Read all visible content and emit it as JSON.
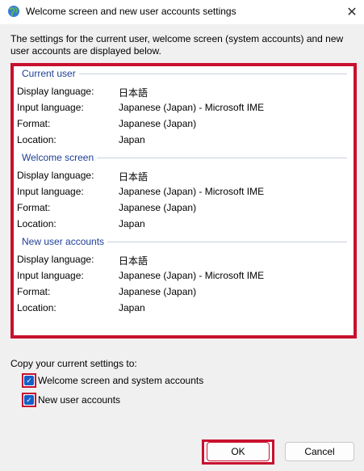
{
  "window": {
    "title": "Welcome screen and new user accounts settings",
    "close_glyph": "✕",
    "icon": "globe-icon"
  },
  "intro": "The settings for the current user, welcome screen (system accounts) and new user accounts are displayed below.",
  "sections": [
    {
      "title": "Current user",
      "rows": [
        {
          "label": "Display language:",
          "value": "日本語"
        },
        {
          "label": "Input language:",
          "value": "Japanese (Japan) - Microsoft IME"
        },
        {
          "label": "Format:",
          "value": "Japanese (Japan)"
        },
        {
          "label": "Location:",
          "value": "Japan"
        }
      ]
    },
    {
      "title": "Welcome screen",
      "rows": [
        {
          "label": "Display language:",
          "value": "日本語"
        },
        {
          "label": "Input language:",
          "value": "Japanese (Japan) - Microsoft IME"
        },
        {
          "label": "Format:",
          "value": "Japanese (Japan)"
        },
        {
          "label": "Location:",
          "value": "Japan"
        }
      ]
    },
    {
      "title": "New user accounts",
      "rows": [
        {
          "label": "Display language:",
          "value": "日本語"
        },
        {
          "label": "Input language:",
          "value": "Japanese (Japan) - Microsoft IME"
        },
        {
          "label": "Format:",
          "value": "Japanese (Japan)"
        },
        {
          "label": "Location:",
          "value": "Japan"
        }
      ]
    }
  ],
  "copy": {
    "label": "Copy your current settings to:",
    "options": [
      {
        "label": "Welcome screen and system accounts",
        "checked": true
      },
      {
        "label": "New user accounts",
        "checked": true
      }
    ]
  },
  "buttons": {
    "ok": "OK",
    "cancel": "Cancel"
  },
  "colors": {
    "highlight": "#c8102e",
    "section_title": "#1e3f96",
    "checkbox": "#1560c8"
  }
}
